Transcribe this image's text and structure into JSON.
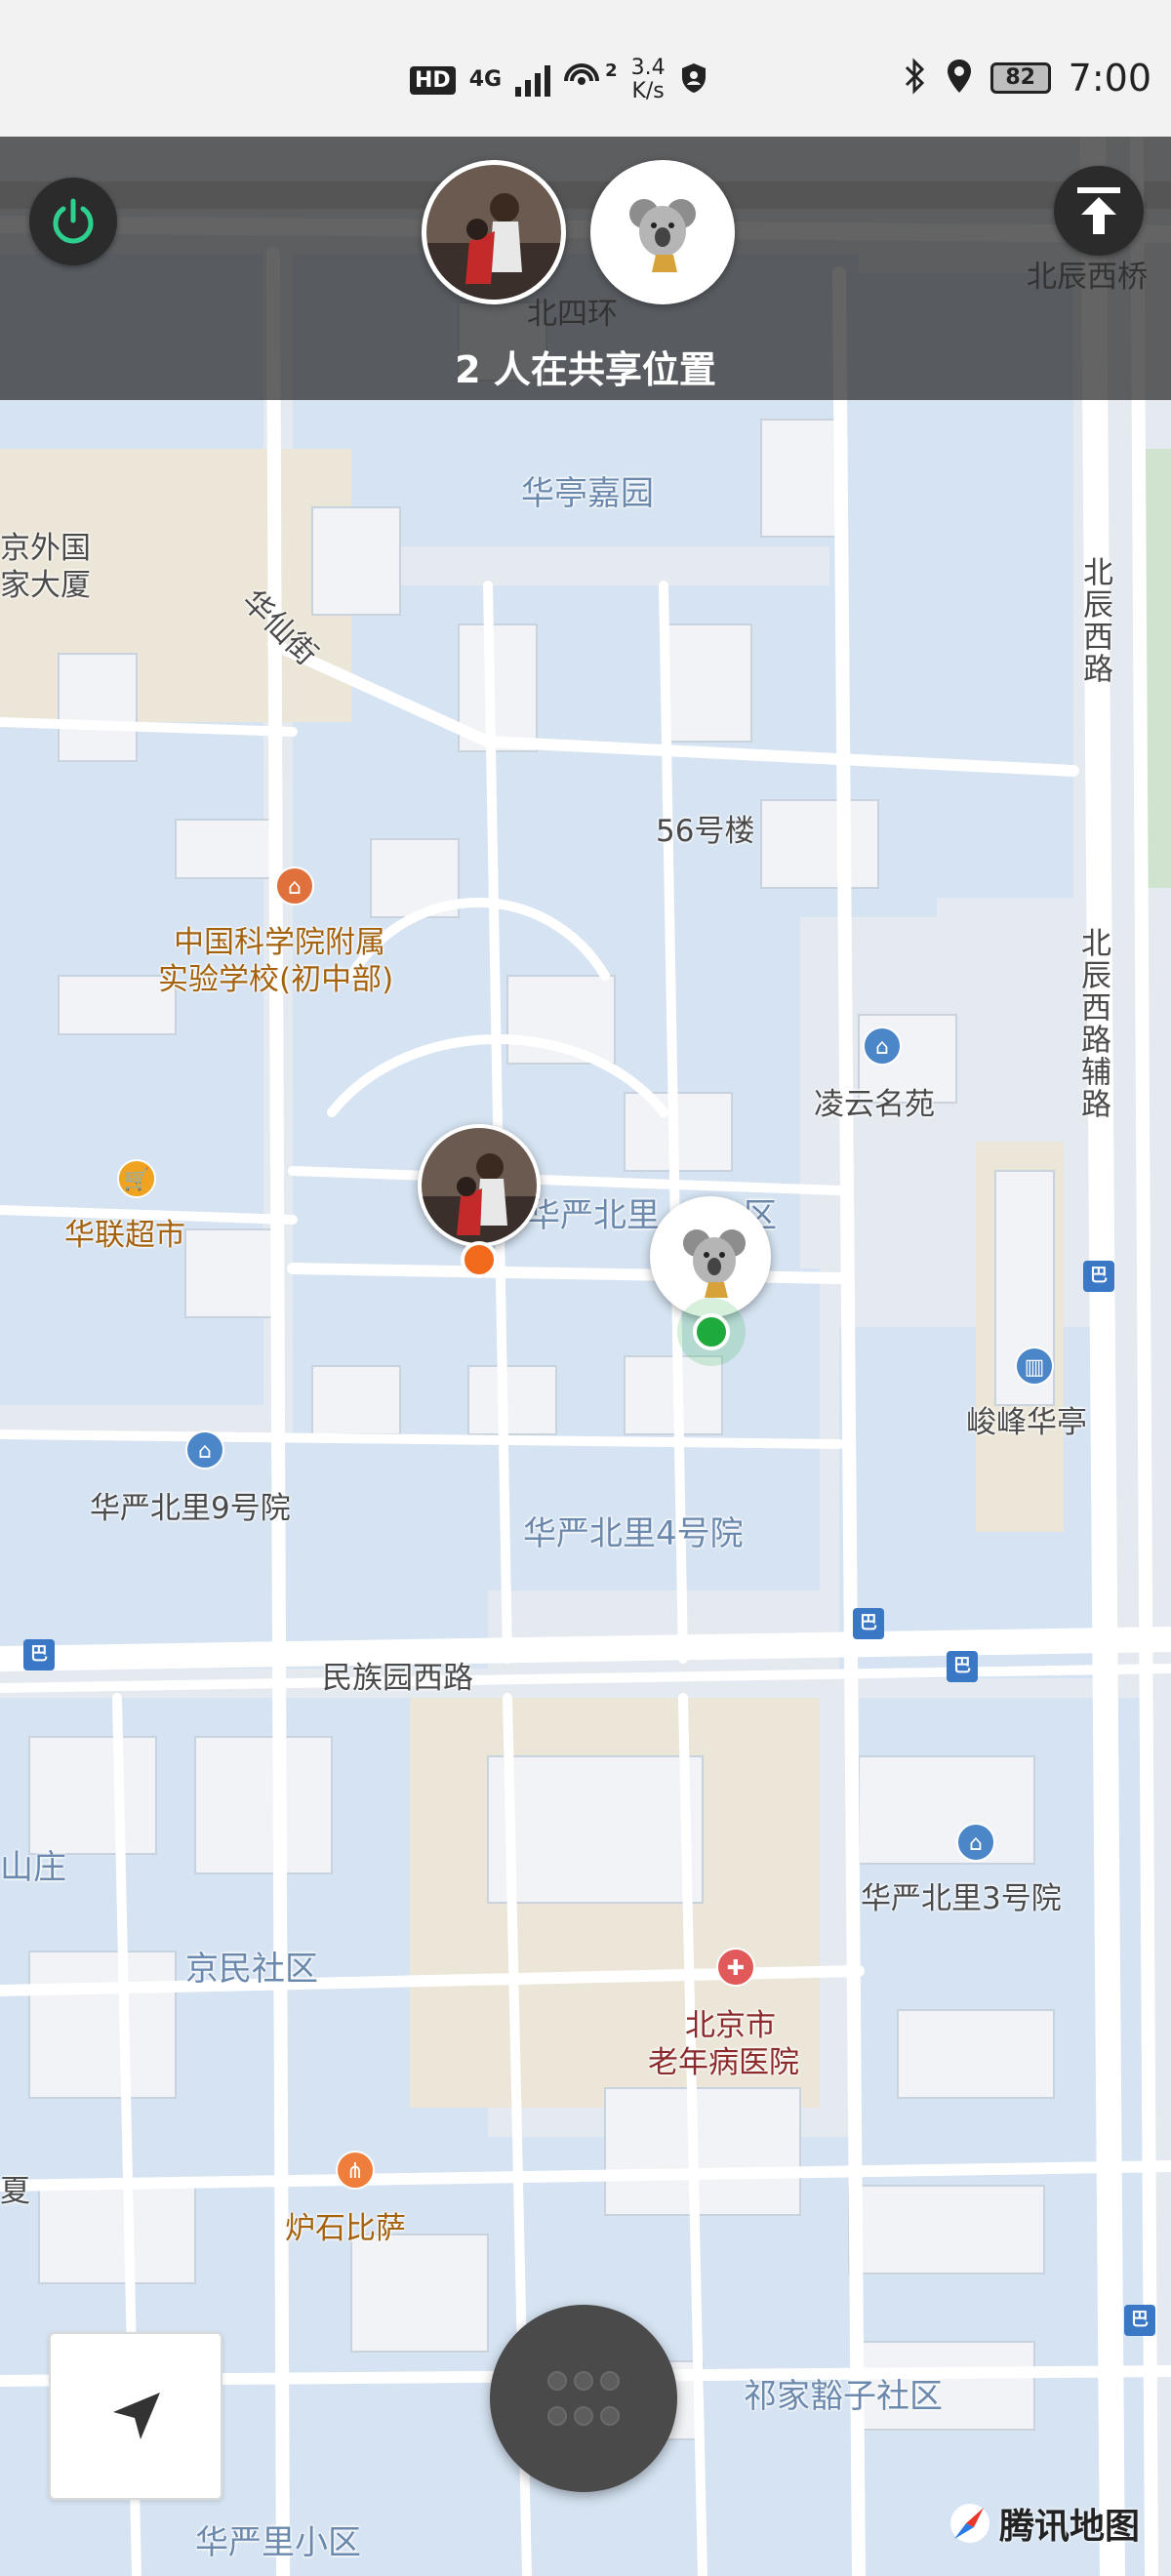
{
  "status_bar": {
    "hd_badge": "HD",
    "network_type": "4G",
    "wifi_sub": "2",
    "speed_value": "3.4",
    "speed_unit": "K/s",
    "battery": "82",
    "time": "7:00"
  },
  "share_overlay": {
    "count_text": "2 人在共享位置"
  },
  "map": {
    "labels": {
      "huating_jiayuan": "华亭嘉园",
      "beisihuan": "北四环",
      "beichen_xiqiao": "北辰西桥",
      "jingwaiguo_dasha_1": "京外国",
      "jingwaiguo_dasha_2": "家大厦",
      "huaxian_jie": "华仙街",
      "beichen_xilu": "北辰西路",
      "building_56": "56号楼",
      "cas_school_1": "中国科学院附属",
      "cas_school_2": "实验学校(初中部)",
      "beichen_xilu_fulu": "北辰西路辅路",
      "lingyun_mingyuan": "凌云名苑",
      "hualian_supermarket": "华联超市",
      "huayan_beili_qu": "华严北里",
      "huayan_beili_qu_suffix": "区",
      "junfeng_huating": "峻峰华亭",
      "huayan_beili_9": "华严北里9号院",
      "huayan_beili_4": "华严北里4号院",
      "minzuyuan_xilu": "民族园西路",
      "shanzhuang": "山庄",
      "huayan_beili_3": "华严北里3号院",
      "jingmin_shequ": "京民社区",
      "hospital_1": "北京市",
      "hospital_2": "老年病医院",
      "xia": "夏",
      "lushi_pizza": "炉石比萨",
      "qijia_huozi_shequ": "祁家豁子社区",
      "huayanli_xiaoqu": "华严里小区"
    }
  },
  "brand": {
    "name": "腾讯地图"
  },
  "colors": {
    "power_green": "#2ecf8f",
    "orange_marker": "#f26b1d",
    "green_marker": "#1eaa3c",
    "map_block": "#d8e6f4",
    "map_road": "#ffffff"
  },
  "icons": {
    "power": "power-icon",
    "share_up": "upload-arrow-icon",
    "locate": "navigation-arrow-icon",
    "menu": "grid-dots-icon",
    "brand": "tencent-map-logo-icon"
  }
}
